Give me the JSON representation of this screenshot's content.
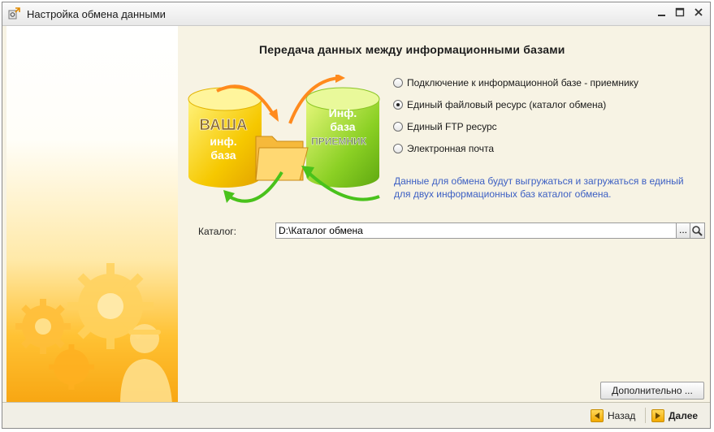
{
  "window": {
    "title": "Настройка обмена данными",
    "icon": "exchange-settings-icon",
    "controls": [
      "minimize-icon",
      "maximize-icon",
      "close-icon"
    ]
  },
  "main": {
    "heading": "Передача данных между информационными базами",
    "illustration": {
      "source_db": {
        "line1": "ВАША",
        "line2": "инф.",
        "line3": "база"
      },
      "target_db": {
        "line1": "Инф.",
        "line2": "база",
        "line3": "ПРИЕМНИК"
      }
    },
    "transport_options": [
      {
        "label": "Подключение к информационной базе - приемнику",
        "selected": false
      },
      {
        "label": "Единый файловый ресурс (каталог обмена)",
        "selected": true
      },
      {
        "label": "Единый FTP ресурс",
        "selected": false
      },
      {
        "label": "Электронная почта",
        "selected": false
      }
    ],
    "info_text": "Данные для обмена будут выгружаться и загружаться в единый для двух информационных баз каталог обмена.",
    "catalog": {
      "label": "Каталог:",
      "value": "D:\\Каталог обмена",
      "choose_label": "..."
    },
    "more_button": "Дополнительно ..."
  },
  "footer": {
    "back_label": "Назад",
    "next_label": "Далее"
  },
  "colors": {
    "info_text": "#3c5fc3",
    "yellow_db": "#f5c400",
    "green_db": "#7dc41b",
    "arrow_orange": "#ff8a1d",
    "arrow_green": "#49c21b"
  }
}
